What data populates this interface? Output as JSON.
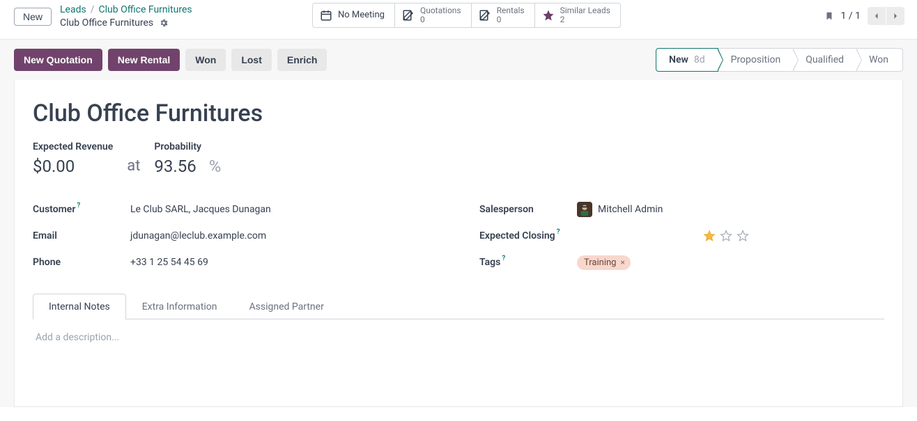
{
  "header": {
    "new_btn": "New",
    "breadcrumb_root": "Leads",
    "breadcrumb_current": "Club Office Furnitures",
    "subtitle": "Club Office Furnitures",
    "pager": "1 / 1"
  },
  "stats": {
    "meeting": {
      "label": "No Meeting"
    },
    "quotations": {
      "label": "Quotations",
      "value": "0"
    },
    "rentals": {
      "label": "Rentals",
      "value": "0"
    },
    "similar": {
      "label": "Similar Leads",
      "value": "2"
    }
  },
  "actions": {
    "new_quotation": "New Quotation",
    "new_rental": "New Rental",
    "won": "Won",
    "lost": "Lost",
    "enrich": "Enrich"
  },
  "stages": {
    "s0": {
      "name": "New",
      "days": "8d"
    },
    "s1": {
      "name": "Proposition"
    },
    "s2": {
      "name": "Qualified"
    },
    "s3": {
      "name": "Won"
    }
  },
  "form": {
    "title": "Club Office Furnitures",
    "expected_revenue_label": "Expected Revenue",
    "expected_revenue": "$0.00",
    "probability_label": "Probability",
    "at": "at",
    "probability": "93.56",
    "pct_sign": "%",
    "customer_label": "Customer",
    "customer": "Le Club SARL, Jacques Dunagan",
    "email_label": "Email",
    "email": "jdunagan@leclub.example.com",
    "phone_label": "Phone",
    "phone": "+33 1 25 54 45 69",
    "salesperson_label": "Salesperson",
    "salesperson": "Mitchell Admin",
    "expected_closing_label": "Expected Closing",
    "tags_label": "Tags",
    "tag0": "Training",
    "priority_stars": 1
  },
  "tabs": {
    "t0": "Internal Notes",
    "t1": "Extra Information",
    "t2": "Assigned Partner"
  },
  "notes_placeholder": "Add a description..."
}
